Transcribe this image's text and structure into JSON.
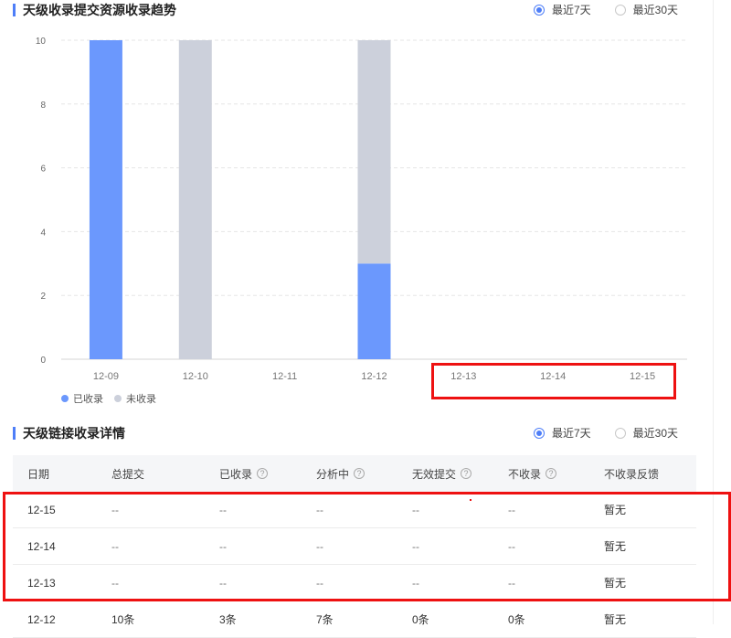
{
  "trend_section": {
    "title": "天级收录提交资源收录趋势",
    "radio": {
      "options": [
        "最近7天",
        "最近30天"
      ],
      "selected": "最近7天"
    }
  },
  "chart_data": {
    "type": "bar",
    "stacked": true,
    "categories": [
      "12-09",
      "12-10",
      "12-11",
      "12-12",
      "12-13",
      "12-14",
      "12-15"
    ],
    "series": [
      {
        "name": "已收录",
        "color": "#6b98fd",
        "values": [
          10,
          0,
          0,
          3,
          0,
          0,
          0
        ]
      },
      {
        "name": "未收录",
        "color": "#ccd0db",
        "values": [
          0,
          10,
          0,
          7,
          0,
          0,
          0
        ]
      }
    ],
    "ylim": [
      0,
      10
    ],
    "yticks": [
      0,
      2,
      4,
      6,
      8,
      10
    ],
    "grid": true,
    "legend_position": "bottom-left"
  },
  "detail_section": {
    "title": "天级链接收录详情",
    "radio": {
      "options": [
        "最近7天",
        "最近30天"
      ],
      "selected": "最近7天"
    }
  },
  "table": {
    "headers": [
      {
        "label": "日期",
        "help": false
      },
      {
        "label": "总提交",
        "help": false
      },
      {
        "label": "已收录",
        "help": true
      },
      {
        "label": "分析中",
        "help": true
      },
      {
        "label": "无效提交",
        "help": true
      },
      {
        "label": "不收录",
        "help": true
      },
      {
        "label": "不收录反馈",
        "help": false
      }
    ],
    "help_glyph": "?",
    "rows": [
      [
        "12-15",
        "--",
        "--",
        "--",
        "--",
        "--",
        "暂无"
      ],
      [
        "12-14",
        "--",
        "--",
        "--",
        "--",
        "--",
        "暂无"
      ],
      [
        "12-13",
        "--",
        "--",
        "--",
        "--",
        "--",
        "暂无"
      ],
      [
        "12-12",
        "10条",
        "3条",
        "7条",
        "0条",
        "0条",
        "暂无"
      ]
    ]
  },
  "annotation_color": "#ee1111"
}
